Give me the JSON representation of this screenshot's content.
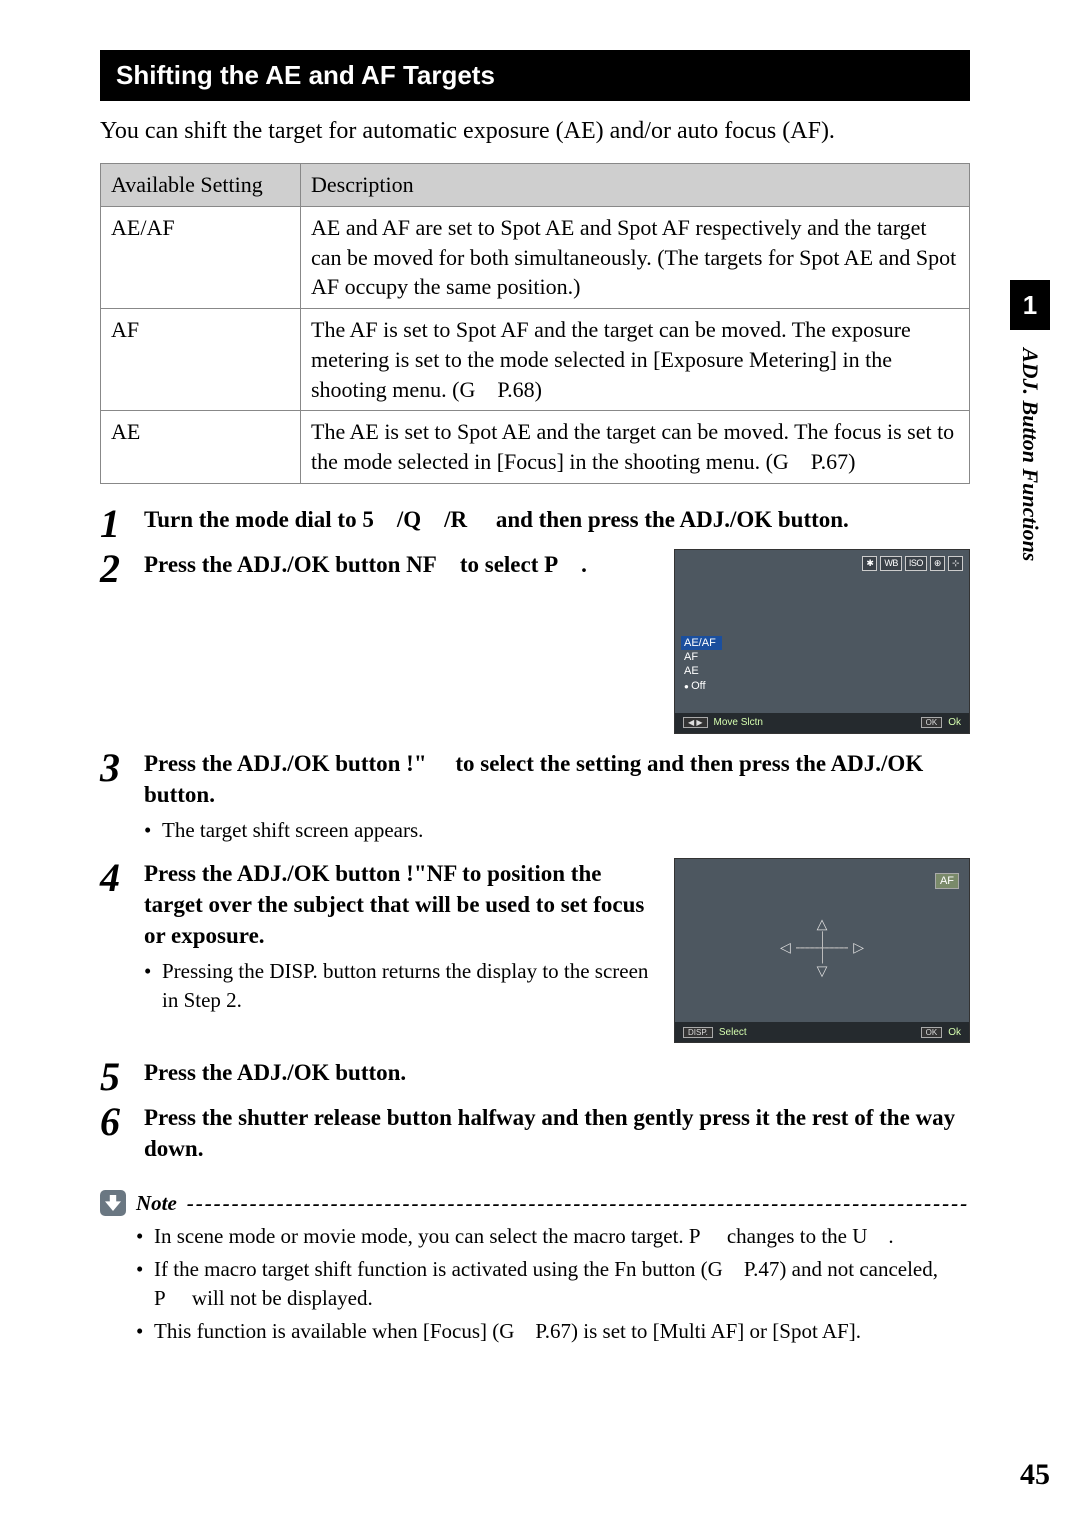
{
  "section_title": "Shifting the AE and AF Targets",
  "intro": "You can shift the target for automatic exposure (AE) and/or auto focus (AF).",
  "table": {
    "headers": [
      "Available Setting",
      "Description"
    ],
    "rows": [
      {
        "setting": "AE/AF",
        "desc": "AE and AF are set to Spot AE and Spot AF respectively and the target can be moved for both simultaneously. (The targets for Spot AE and Spot AF occupy the same position.)"
      },
      {
        "setting": "AF",
        "desc": "The AF is set to Spot AF and the target can be moved. The exposure metering is set to the mode selected in [Exposure Metering] in the shooting menu. (G P.68)"
      },
      {
        "setting": "AE",
        "desc": "The AE is set to Spot AE and the target can be moved. The focus is set to the mode selected in [Focus] in the shooting menu. (G P.67)"
      }
    ]
  },
  "steps": [
    {
      "text": "Turn the mode dial to 5 /Q /R  and then press the ADJ./OK button."
    },
    {
      "text": "Press the ADJ./OK button NF to select P ."
    },
    {
      "text": "Press the ADJ./OK button !\"  to select the setting and then press the ADJ./OK button.",
      "sub": "The target shift screen appears."
    },
    {
      "text": "Press the ADJ./OK button !\"NF to position the target over the subject that will be used to set focus or exposure.",
      "sub": "Pressing the DISP. button returns the display to the screen in Step 2."
    },
    {
      "text": "Press the ADJ./OK button."
    },
    {
      "text": "Press the shutter release button halfway and then gently press it the rest of the way down."
    }
  ],
  "screen1": {
    "icons": [
      "✱",
      "WB",
      "ISO",
      "⊕",
      "⊹"
    ],
    "menu": [
      "AE/AF",
      "AF",
      "AE",
      "Off"
    ],
    "bottom_left_btn": "◀ ▶",
    "bottom_left_label": "Move Slctn",
    "bottom_right_btn": "OK",
    "bottom_right_label": "Ok"
  },
  "screen2": {
    "badge": "AF",
    "bottom_left_btn": "DISP.",
    "bottom_left_label": "Select",
    "bottom_right_btn": "OK",
    "bottom_right_label": "Ok"
  },
  "note": {
    "heading": "Note",
    "dashes": "---------------------------------------------------------------------------------------",
    "items": [
      "In scene mode or movie mode, you can select the macro target. P  changes to the U .",
      "If the macro target shift function is activated using the Fn button (G P.47) and not canceled, P  will not be displayed.",
      "This function is available when [Focus] (G P.67) is set to [Multi AF] or [Spot AF]."
    ]
  },
  "sidebar": {
    "chapter": "1",
    "label": "ADJ. Button Functions"
  },
  "page_number": "45"
}
